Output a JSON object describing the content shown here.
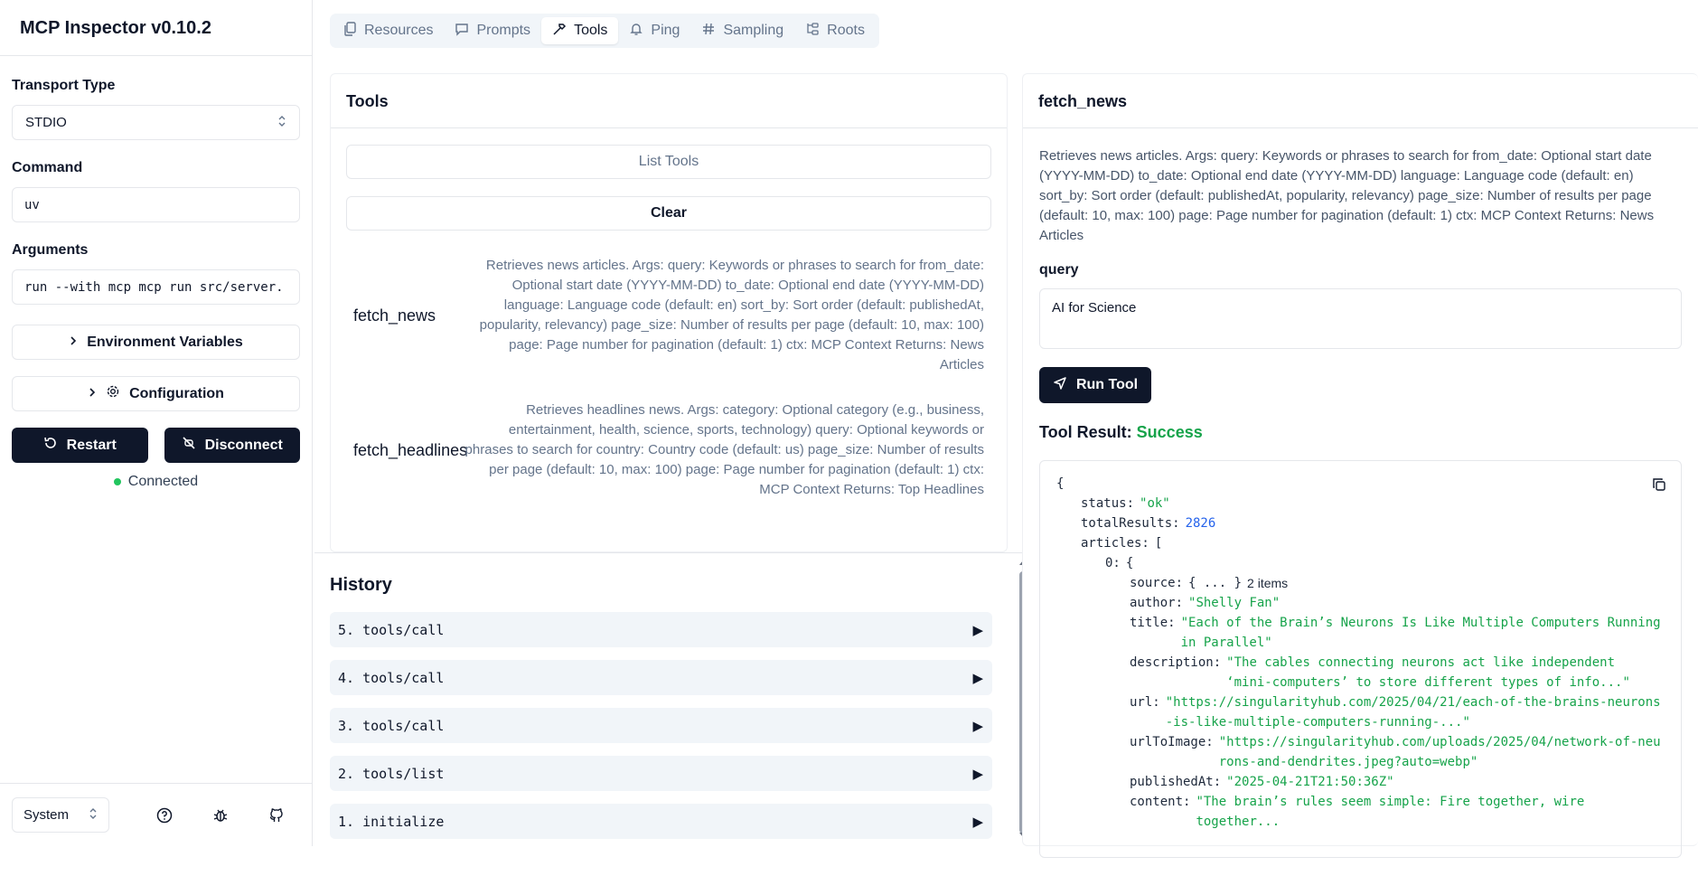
{
  "app": {
    "title": "MCP Inspector v0.10.2"
  },
  "sidebar": {
    "transport_label": "Transport Type",
    "transport_value": "STDIO",
    "command_label": "Command",
    "command_value": "uv",
    "arguments_label": "Arguments",
    "arguments_value": "run --with mcp mcp run src/server.",
    "env_label": "Environment Variables",
    "config_label": "Configuration",
    "restart_label": "Restart",
    "disconnect_label": "Disconnect",
    "status": "Connected",
    "theme_value": "System"
  },
  "tabs": [
    {
      "label": "Resources",
      "icon": "file-icon"
    },
    {
      "label": "Prompts",
      "icon": "message-icon"
    },
    {
      "label": "Tools",
      "icon": "hammer-icon",
      "active": true
    },
    {
      "label": "Ping",
      "icon": "bell-icon"
    },
    {
      "label": "Sampling",
      "icon": "hash-icon"
    },
    {
      "label": "Roots",
      "icon": "folder-tree-icon"
    }
  ],
  "tools_panel": {
    "title": "Tools",
    "list_label": "List Tools",
    "clear_label": "Clear",
    "tools": [
      {
        "name": "fetch_news",
        "description": "Retrieves news articles. Args: query: Keywords or phrases to search for from_date: Optional start date (YYYY-MM-DD) to_date: Optional end date (YYYY-MM-DD) language: Language code (default: en) sort_by: Sort order (default: publishedAt, popularity, relevancy) page_size: Number of results per page (default: 10, max: 100) page: Page number for pagination (default: 1) ctx: MCP Context Returns: News Articles"
      },
      {
        "name": "fetch_headlines",
        "description": "Retrieves headlines news. Args: category: Optional category (e.g., business, entertainment, health, science, sports, technology) query: Optional keywords or phrases to search for country: Country code (default: us) page_size: Number of results per page (default: 10, max: 100) page: Page number for pagination (default: 1) ctx: MCP Context Returns: Top Headlines"
      }
    ]
  },
  "history": {
    "title": "History",
    "items": [
      "5. tools/call",
      "4. tools/call",
      "3. tools/call",
      "2. tools/list",
      "1. initialize"
    ],
    "expand_glyph": "▶"
  },
  "detail": {
    "title": "fetch_news",
    "description": "Retrieves news articles. Args: query: Keywords or phrases to search for from_date: Optional start date (YYYY-MM-DD) to_date: Optional end date (YYYY-MM-DD) language: Language code (default: en) sort_by: Sort order (default: publishedAt, popularity, relevancy) page_size: Number of results per page (default: 10, max: 100) page: Page number for pagination (default: 1) ctx: MCP Context Returns: News Articles",
    "query_label": "query",
    "query_value": "AI for Science",
    "run_label": "Run Tool",
    "result_label": "Tool Result:",
    "result_status": "Success"
  },
  "result_json": {
    "open_brace": "{",
    "status_key": "status:",
    "status_val": "\"ok\"",
    "total_key": "totalResults:",
    "total_val": "2826",
    "articles_key": "articles:",
    "articles_open": "[",
    "item0_key": "0:",
    "item0_open": "{",
    "source_key": "source:",
    "source_val": "{ ... }",
    "source_count": "2 items",
    "author_key": "author:",
    "author_val": "\"Shelly Fan\"",
    "title_key": "title:",
    "title_val": "\"Each of the Brain’s Neurons Is Like Multiple Computers Running in Parallel\"",
    "desc_key": "description:",
    "desc_val": "\"The cables connecting neurons act like independent ‘mini-computers’ to store different types of info...\"",
    "url_key": "url:",
    "url_val": "\"https://singularityhub.com/2025/04/21/each-of-the-brains-neurons-is-like-multiple-computers-running-...\"",
    "img_key": "urlToImage:",
    "img_val": "\"https://singularityhub.com/uploads/2025/04/network-of-neurons-and-dendrites.jpeg?auto=webp\"",
    "pub_key": "publishedAt:",
    "pub_val": "\"2025-04-21T21:50:36Z\"",
    "content_key": "content:",
    "content_val": "\"The brain’s rules seem simple: Fire together, wire together..."
  }
}
